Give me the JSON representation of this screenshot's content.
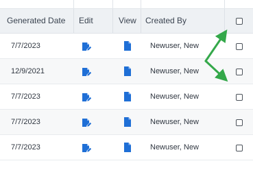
{
  "columns": {
    "generated_date": "Generated Date",
    "edit": "Edit",
    "view": "View",
    "created_by": "Created By"
  },
  "rows": [
    {
      "generated_date": "7/7/2023",
      "created_by": "Newuser, New"
    },
    {
      "generated_date": "12/9/2021",
      "created_by": "Newuser, New"
    },
    {
      "generated_date": "7/7/2023",
      "created_by": "Newuser, New"
    },
    {
      "generated_date": "7/7/2023",
      "created_by": "Newuser, New"
    },
    {
      "generated_date": "7/7/2023",
      "created_by": "Newuser, New"
    }
  ],
  "icons": {
    "edit": "edit-document-icon",
    "view": "document-icon",
    "annotation": "green-arrow"
  },
  "colors": {
    "header_bg": "#eef1f4",
    "icon_blue": "#1f6fd6",
    "arrow_green": "#34a84a"
  }
}
